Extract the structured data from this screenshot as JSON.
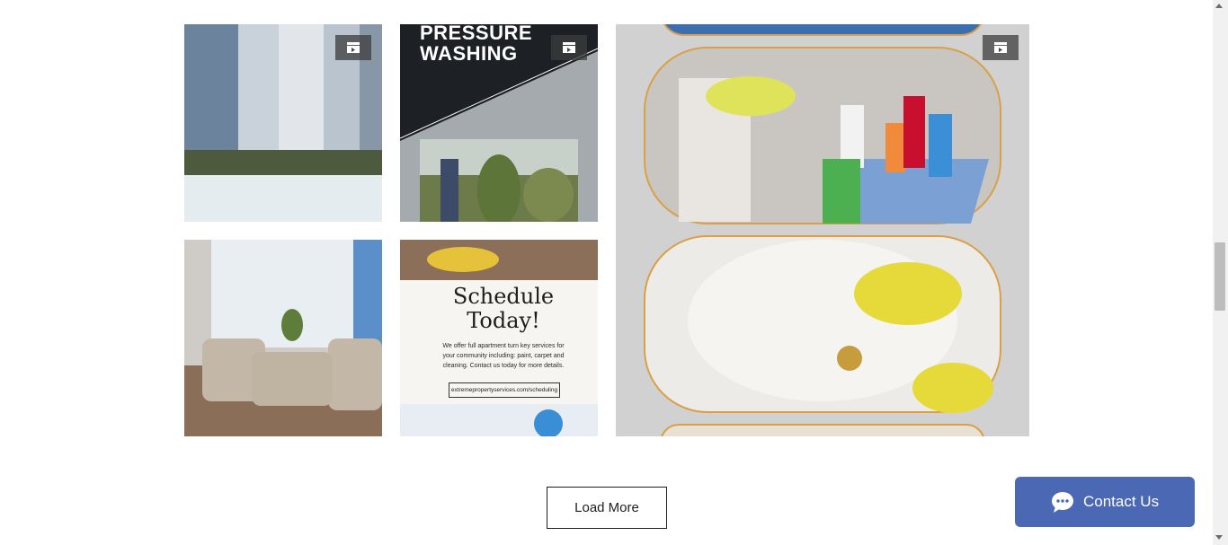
{
  "gallery": {
    "items": [
      {
        "kind": "photo",
        "subject": "high-rise buildings",
        "has_video": true
      },
      {
        "kind": "graphic",
        "title_lines": [
          "PRESSURE",
          "WASHING"
        ],
        "has_video": true
      },
      {
        "kind": "collage",
        "subject": "cleaning supplies and sink",
        "has_video": true
      },
      {
        "kind": "photo",
        "subject": "apartment living room"
      },
      {
        "kind": "graphic",
        "title_lines": [
          "Schedule",
          "Today!"
        ],
        "body": "We offer full apartment turn key services for your community including: paint, carpet and cleaning. Contact us today for more details.",
        "link": "extremepropertyservices.com/scheduling"
      }
    ],
    "video_icon": "clapperboard-icon"
  },
  "actions": {
    "load_more_label": "Load More"
  },
  "chat_widget": {
    "label": "Contact Us",
    "icon": "chat-bubble-icon",
    "color": "#4a68b3"
  }
}
